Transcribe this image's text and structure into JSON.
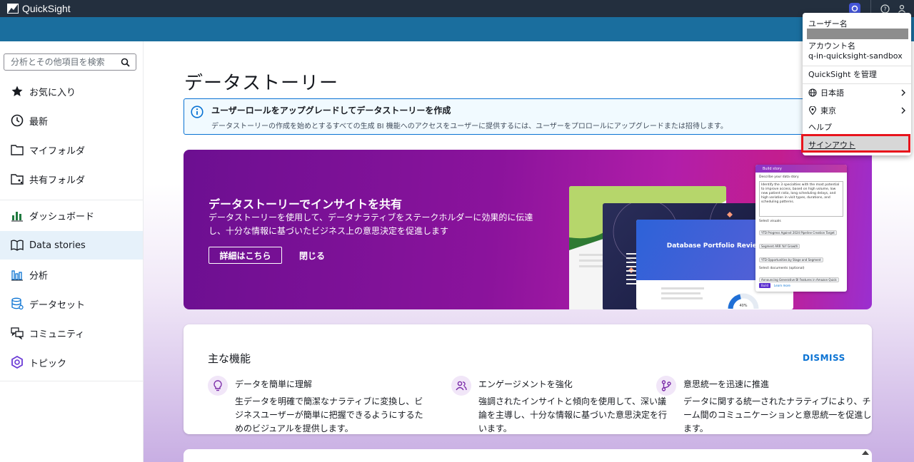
{
  "app": {
    "title": "QuickSight"
  },
  "sidebar": {
    "search_placeholder": "分析とその他項目を検索",
    "items": [
      {
        "label": "お気に入り",
        "icon": "star-icon"
      },
      {
        "label": "最新",
        "icon": "clock-icon"
      },
      {
        "label": "マイフォルダ",
        "icon": "folder-icon"
      },
      {
        "label": "共有フォルダ",
        "icon": "shared-folder-icon"
      },
      {
        "label": "ダッシュボード",
        "icon": "dashboard-icon"
      },
      {
        "label": "Data stories",
        "icon": "book-icon",
        "active": true
      },
      {
        "label": "分析",
        "icon": "analysis-icon"
      },
      {
        "label": "データセット",
        "icon": "dataset-icon"
      },
      {
        "label": "コミュニティ",
        "icon": "community-icon"
      },
      {
        "label": "トピック",
        "icon": "topic-icon"
      }
    ]
  },
  "main": {
    "title": "データストーリー",
    "info": {
      "title": "ユーザーロールをアップグレードしてデータストーリーを作成",
      "text": "データストーリーの作成を始めとするすべての生成 BI 機能へのアクセスをユーザーに提供するには、ユーザーをプロロールにアップグレードまたは招待します。"
    },
    "hero": {
      "title": "データストーリーでインサイトを共有",
      "desc": "データストーリーを使用して、データナラティブをステークホルダーに効果的に伝達し、十分な情報に基づいたビジネス上の意思決定を促進します",
      "learn_more": "詳細はこちら",
      "close": "閉じる",
      "preview": {
        "card_title": "Database Portfolio Review",
        "panel_title": "Build story",
        "describe_label": "Describe your data story",
        "describe_text": "Identify the 3 specialties with the most potential to improve access, based on high volume, low new patient ratio, long scheduling delays, and high variation in visit types, durations, and scheduling patterns.",
        "visuals_label": "Select visuals",
        "visual_chips": [
          "YTD Progress Against 2024 Pipeline Creation Target",
          "Segment ARR YoY Growth",
          "YTD Opportunities by Stage and Segment"
        ],
        "documents_label": "Select documents (optional)",
        "document_chips": [
          "Announcing Generative BI Features in Amazon Quick"
        ],
        "build": "Build",
        "learn": "Learn more",
        "gauge_value": "40%"
      }
    },
    "features": {
      "title": "主な機能",
      "dismiss": "DISMISS",
      "items": [
        {
          "name": "データを簡単に理解",
          "desc": "生データを明確で簡潔なナラティブに変換し、ビジネスユーザーが簡単に把握できるようにするためのビジュアルを提供します。",
          "icon": "lightbulb-icon"
        },
        {
          "name": "エンゲージメントを強化",
          "desc": "強調されたインサイトと傾向を使用して、深い議論を主導し、十分な情報に基づいた意思決定を行います。",
          "icon": "users-icon"
        },
        {
          "name": "意思統一を迅速に推進",
          "desc": "データに関する統一されたナラティブにより、チーム間のコミュニケーションと意思統一を促進します。",
          "icon": "branch-icon"
        }
      ]
    }
  },
  "user_menu": {
    "username_label": "ユーザー名",
    "account_label": "アカウント名",
    "account_name": "q-in-quicksight-sandbox",
    "manage": "QuickSight を管理",
    "language": "日本語",
    "region": "東京",
    "help": "ヘルプ",
    "signout": "サインアウト"
  },
  "colors": {
    "accent": "#0972d3",
    "topbar": "#232f3e",
    "band": "#1a6e9e",
    "highlight": "#e8141c"
  }
}
